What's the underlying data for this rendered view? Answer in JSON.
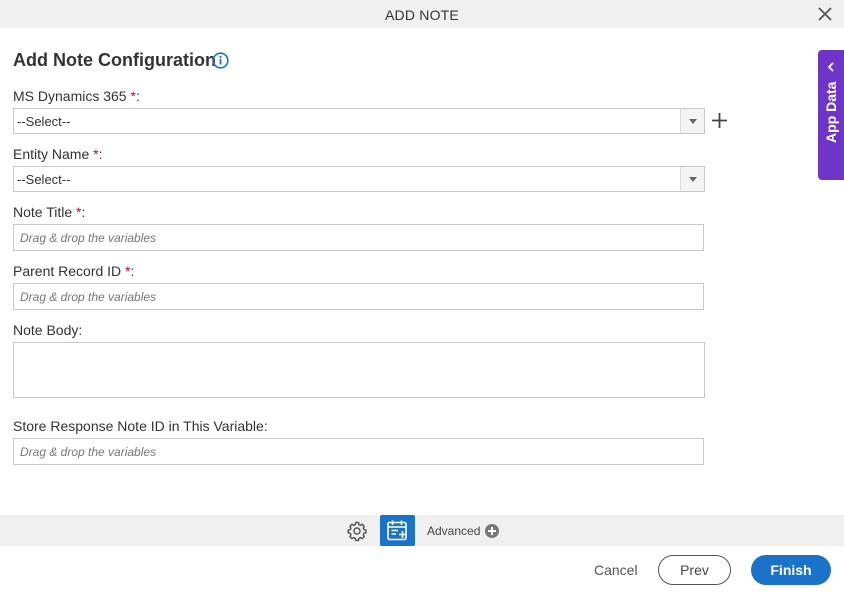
{
  "dialog": {
    "title": "ADD NOTE"
  },
  "heading": "Add Note Configuration",
  "fields": {
    "ms_dynamics": {
      "label": "MS Dynamics 365 ",
      "required": "*",
      "colon": ":",
      "value": "--Select--"
    },
    "entity_name": {
      "label": "Entity Name ",
      "required": "*",
      "colon": ":",
      "value": "--Select--"
    },
    "note_title": {
      "label": "Note Title ",
      "required": "*",
      "colon": ":",
      "placeholder": "Drag & drop the variables"
    },
    "parent_record_id": {
      "label": "Parent Record ID ",
      "required": "*",
      "colon": ":",
      "placeholder": "Drag & drop the variables"
    },
    "note_body": {
      "label": "Note Body:"
    },
    "store_response": {
      "label": "Store Response Note ID in This Variable:",
      "placeholder": "Drag & drop the variables"
    }
  },
  "side_panel": {
    "label": "App Data"
  },
  "toolbar": {
    "advanced_label": "Advanced"
  },
  "footer": {
    "cancel": "Cancel",
    "prev": "Prev",
    "finish": "Finish"
  },
  "colors": {
    "accent": "#1a73c8",
    "app_data": "#6f35c9",
    "required": "#d0021b"
  }
}
